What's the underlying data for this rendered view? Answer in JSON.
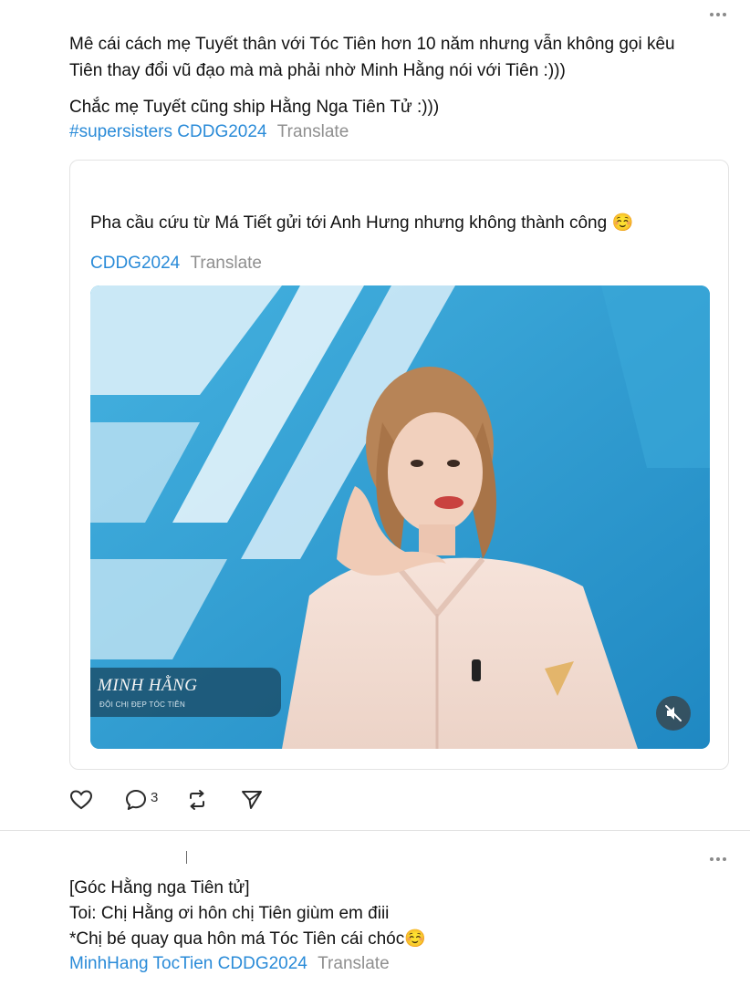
{
  "post": {
    "line1": "Mê cái cách mẹ Tuyết thân với Tóc Tiên hơn 10 năm nhưng vẫn không gọi kêu",
    "line2": "Tiên thay đổi vũ đạo mà mà phải nhờ Minh Hằng nói với Tiên :)))",
    "line3": "Chắc mẹ Tuyết cũng ship Hằng Nga Tiên Tử :)))",
    "tags": [
      "#supersisters",
      "CDDG2024"
    ],
    "translate_label": "Translate"
  },
  "quote": {
    "text": "Pha cầu cứu từ Má Tiết gửi tới Anh Hưng nhưng không thành công ☺️",
    "tags": [
      "CDDG2024"
    ],
    "translate_label": "Translate",
    "video": {
      "name_overlay": "MINH HẰNG",
      "sub_overlay": "ĐỘI CHỊ ĐẸP TÓC TIÊN",
      "muted": true
    }
  },
  "actions": {
    "like_icon": "heart-icon",
    "comment_icon": "comment-icon",
    "comment_count": "3",
    "repost_icon": "repost-icon",
    "share_icon": "send-icon"
  },
  "reply": {
    "line1": "[Góc Hằng nga Tiên tử]",
    "line2": "Toi: Chị Hằng ơi hôn chị Tiên giùm em điii",
    "line3": "*Chị bé quay qua hôn má Tóc Tiên cái chóc☺️",
    "tags": [
      "MinhHang",
      "TocTien",
      "CDDG2024"
    ],
    "translate_label": "Translate"
  },
  "colors": {
    "link": "#2a8bd8",
    "muted_text": "#8f8f8f",
    "border": "#e3e3e3"
  }
}
